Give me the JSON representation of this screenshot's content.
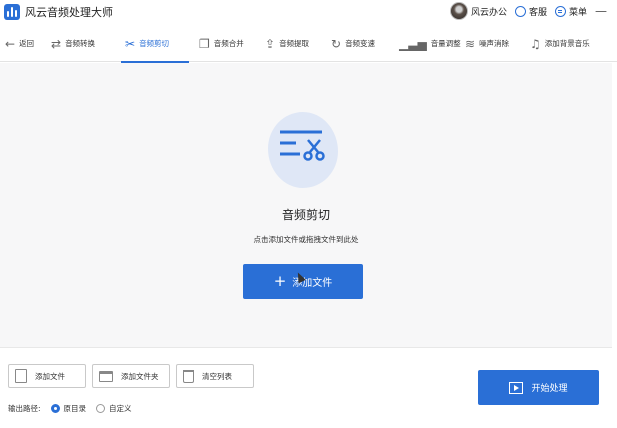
{
  "app": {
    "title": "风云音频处理大师"
  },
  "header": {
    "user_label": "风云办公",
    "service_label": "客服",
    "menu_label": "菜单",
    "minimize": "—"
  },
  "toolbar": {
    "back": "返回",
    "items": [
      {
        "label": "音频转换",
        "icon": "convert-icon"
      },
      {
        "label": "音频剪切",
        "icon": "scissors-icon",
        "active": true
      },
      {
        "label": "音频合并",
        "icon": "merge-icon"
      },
      {
        "label": "音频提取",
        "icon": "extract-icon"
      },
      {
        "label": "音频变速",
        "icon": "speed-icon"
      },
      {
        "label": "音量调整",
        "icon": "volume-icon"
      },
      {
        "label": "噪声消除",
        "icon": "noise-icon"
      },
      {
        "label": "添加背景音乐",
        "icon": "music-icon"
      }
    ]
  },
  "main": {
    "title": "音频剪切",
    "subtitle": "点击添加文件或拖拽文件到此处",
    "add_button": "添加文件"
  },
  "bottom": {
    "add_file": "添加文件",
    "add_folder": "添加文件夹",
    "clear_list": "清空列表",
    "output_label": "输出路径:",
    "radio_original": "原目录",
    "radio_custom": "自定义",
    "start_button": "开始处理"
  },
  "colors": {
    "accent": "#2a6fd6",
    "hero_bg": "#dfe7f6"
  }
}
